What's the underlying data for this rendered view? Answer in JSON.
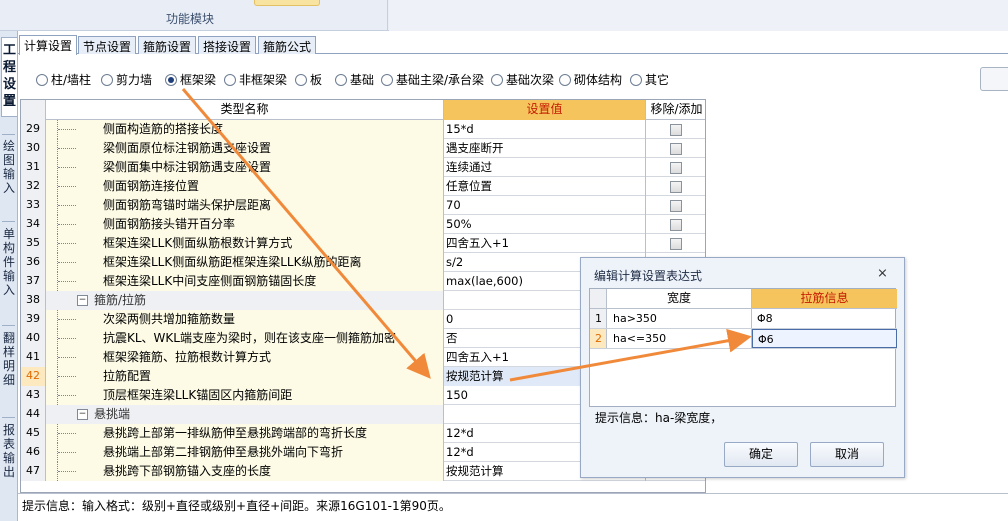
{
  "ribbon": {
    "section_label": "功能模块"
  },
  "vtabs": {
    "items": [
      {
        "label": "工程设置",
        "active": true
      },
      {
        "label": "绘图输入",
        "active": false
      },
      {
        "label": "单构件输入",
        "active": false
      },
      {
        "label": "翻样明细",
        "active": false
      },
      {
        "label": "报表输出",
        "active": false
      }
    ]
  },
  "tabs": [
    "计算设置",
    "节点设置",
    "箍筋设置",
    "搭接设置",
    "箍筋公式"
  ],
  "radios": {
    "items": [
      "柱/墙柱",
      "剪力墙",
      "框架梁",
      "非框架梁",
      "板",
      "基础",
      "基础主梁/承台梁",
      "基础次梁",
      "砌体结构",
      "其它"
    ],
    "selected": "框架梁"
  },
  "side_button": {
    "label": ""
  },
  "grid": {
    "headers": {
      "name": "类型名称",
      "value": "设置值",
      "action": "移除/添加"
    },
    "rows": [
      {
        "num": "29",
        "name": "侧面构造筋的搭接长度",
        "value": "15*d",
        "type": "item"
      },
      {
        "num": "30",
        "name": "梁侧面原位标注钢筋遇支座设置",
        "value": "遇支座断开",
        "type": "item"
      },
      {
        "num": "31",
        "name": "梁侧面集中标注钢筋遇支座设置",
        "value": "连续通过",
        "type": "item"
      },
      {
        "num": "32",
        "name": "侧面钢筋连接位置",
        "value": "任意位置",
        "type": "item"
      },
      {
        "num": "33",
        "name": "侧面钢筋弯锚时端头保护层距离",
        "value": "70",
        "type": "item"
      },
      {
        "num": "34",
        "name": "侧面钢筋接头错开百分率",
        "value": "50%",
        "type": "item"
      },
      {
        "num": "35",
        "name": "框架连梁LLK侧面纵筋根数计算方式",
        "value": "四舍五入+1",
        "type": "item"
      },
      {
        "num": "36",
        "name": "框架连梁LLK侧面纵筋距框架连梁LLK纵筋的距离",
        "value": "s/2",
        "type": "item"
      },
      {
        "num": "37",
        "name": "框架连梁LLK中间支座侧面钢筋锚固长度",
        "value": "max(lae,600)",
        "type": "item"
      },
      {
        "num": "38",
        "name": "箍筋/拉筋",
        "value": "",
        "type": "group"
      },
      {
        "num": "39",
        "name": "次梁两侧共增加箍筋数量",
        "value": "0",
        "type": "item"
      },
      {
        "num": "40",
        "name": "抗震KL、WKL端支座为梁时，则在该支座一侧箍筋加密",
        "value": "否",
        "type": "item"
      },
      {
        "num": "41",
        "name": "框架梁箍筋、拉筋根数计算方式",
        "value": "四舍五入+1",
        "type": "item"
      },
      {
        "num": "42",
        "name": "拉筋配置",
        "value": "按规范计算",
        "type": "selected"
      },
      {
        "num": "43",
        "name": "顶层框架连梁LLK锚固区内箍筋间距",
        "value": "150",
        "type": "item"
      },
      {
        "num": "44",
        "name": "悬挑端",
        "value": "",
        "type": "group"
      },
      {
        "num": "45",
        "name": "悬挑跨上部第一排纵筋伸至悬挑跨端部的弯折长度",
        "value": "12*d",
        "type": "item"
      },
      {
        "num": "46",
        "name": "悬挑端上部第二排钢筋伸至悬挑外端向下弯折",
        "value": "12*d",
        "type": "item"
      },
      {
        "num": "47",
        "name": "悬挑跨下部钢筋锚入支座的长度",
        "value": "按规范计算",
        "type": "item"
      }
    ]
  },
  "status": {
    "text": "提示信息：输入格式：级别+直径或级别+直径+间距。来源16G101-1第90页。"
  },
  "dialog": {
    "title": "编辑计算设置表达式",
    "close_glyph": "⨯",
    "headers": {
      "width": "宽度",
      "rebar": "拉筋信息"
    },
    "rows": [
      {
        "num": "1",
        "width": "ha>350",
        "rebar": "Φ8",
        "selected": false
      },
      {
        "num": "2",
        "width": "ha<=350",
        "rebar": "Φ6",
        "selected": true
      }
    ],
    "hint": "提示信息：ha-梁宽度，",
    "ok_label": "确定",
    "cancel_label": "取消"
  },
  "colors": {
    "accent": "#f5c45d",
    "arrow": "#f08a3a",
    "header_text": "#c51b00"
  },
  "icons": {
    "close": "close-icon",
    "expand": "minus-box-icon"
  }
}
